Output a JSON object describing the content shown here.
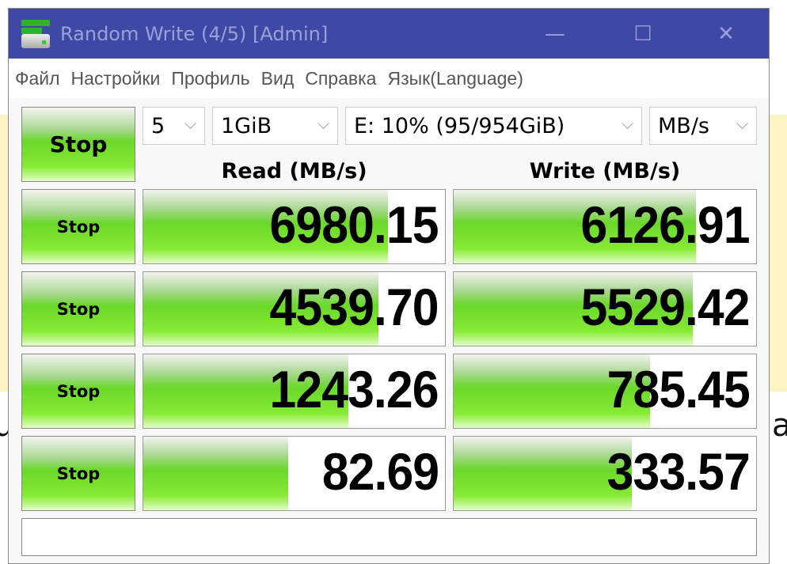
{
  "window": {
    "title": "Random Write (4/5) [Admin]",
    "minimize": "—",
    "maximize": "☐",
    "close": "✕"
  },
  "menu": [
    "Файл",
    "Настройки",
    "Профиль",
    "Вид",
    "Справка",
    "Язык(Language)"
  ],
  "controls": {
    "all_button": "Stop",
    "count": "5",
    "size": "1GiB",
    "drive": "E: 10% (95/954GiB)",
    "unit": "MB/s"
  },
  "headers": {
    "read": "Read (MB/s)",
    "write": "Write (MB/s)"
  },
  "rows": [
    {
      "button": "Stop",
      "read": "6980.15",
      "read_fill": 0.81,
      "write": "6126.91",
      "write_fill": 0.8
    },
    {
      "button": "Stop",
      "read": "4539.70",
      "read_fill": 0.78,
      "write": "5529.42",
      "write_fill": 0.79
    },
    {
      "button": "Stop",
      "read": "1243.26",
      "read_fill": 0.68,
      "write": "785.45",
      "write_fill": 0.65
    },
    {
      "button": "Stop",
      "read": "82.69",
      "read_fill": 0.48,
      "write": "333.57",
      "write_fill": 0.59
    }
  ],
  "comment": "",
  "background_fragments": [
    "u",
    "a"
  ]
}
